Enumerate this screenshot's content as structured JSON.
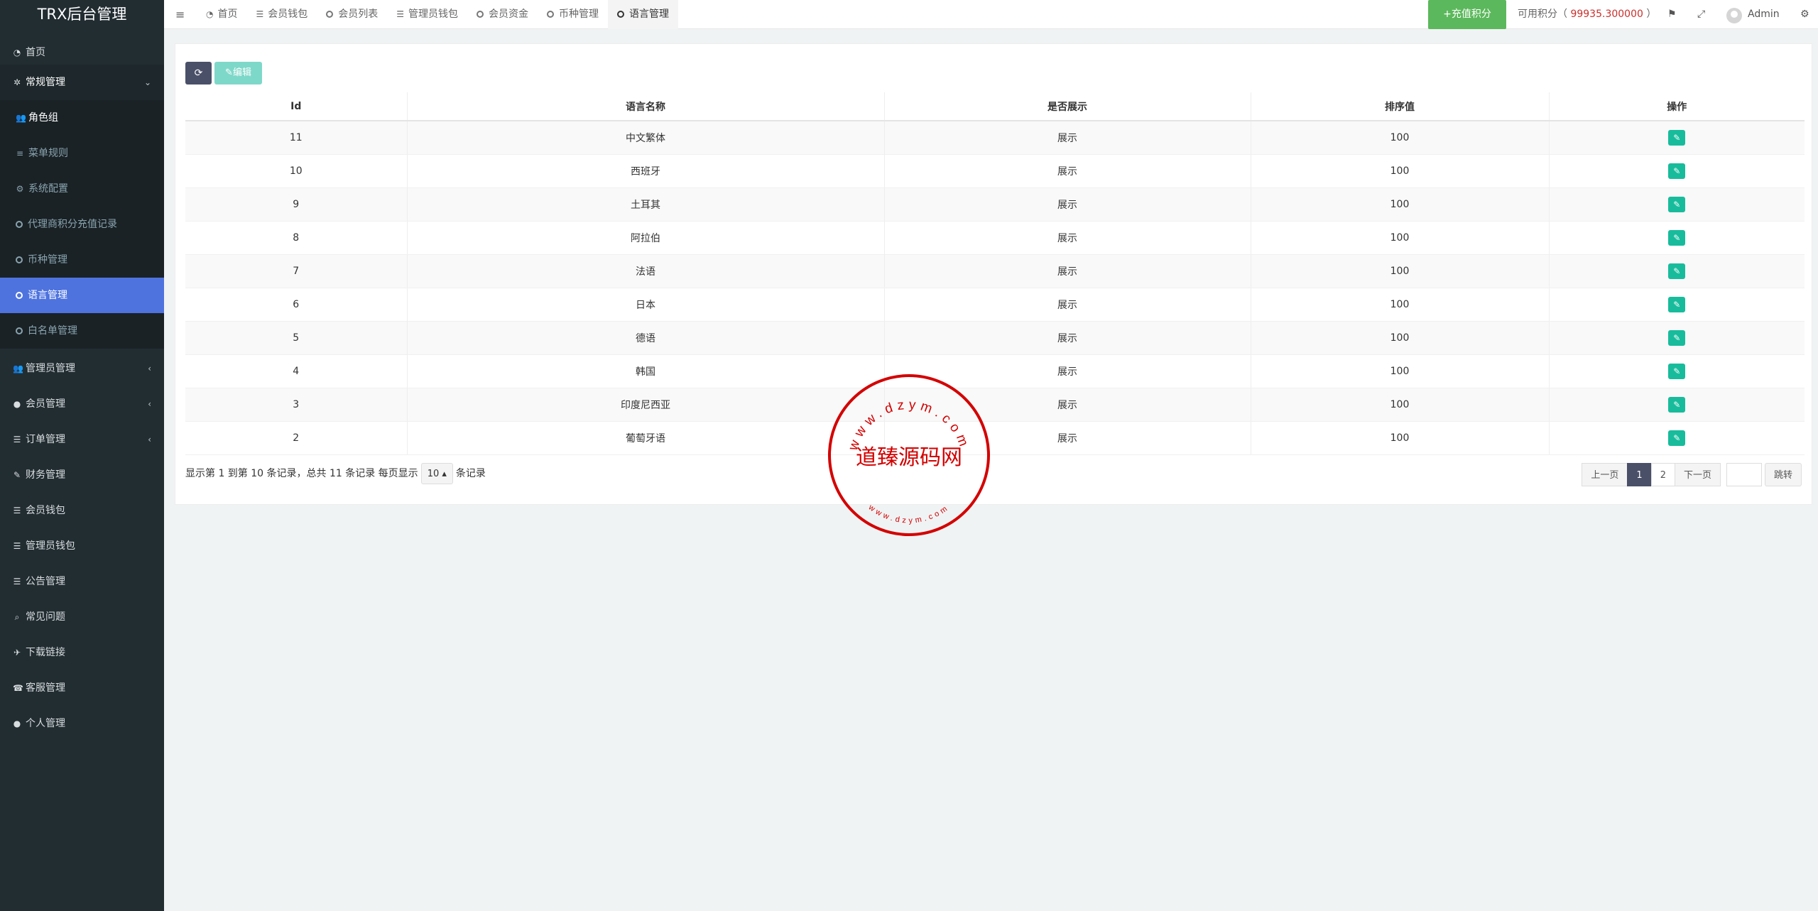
{
  "sidebar": {
    "logo": "TRX后台管理",
    "home": "首页",
    "regular": "常规管理",
    "sub": {
      "role_group": "角色组",
      "menu_rules": "菜单规则",
      "system_config": "系统配置",
      "agent_recharge": "代理商积分充值记录",
      "currency": "币种管理",
      "language": "语言管理",
      "whitelist": "白名单管理"
    },
    "items": [
      {
        "label": "管理员管理",
        "icon": "users-icon",
        "arrow": true
      },
      {
        "label": "会员管理",
        "icon": "user-icon",
        "arrow": true
      },
      {
        "label": "订单管理",
        "icon": "list-icon",
        "arrow": true
      },
      {
        "label": "财务管理",
        "icon": "edit-icon",
        "arrow": false
      },
      {
        "label": "会员钱包",
        "icon": "list-icon",
        "arrow": false
      },
      {
        "label": "管理员钱包",
        "icon": "list-icon",
        "arrow": false
      },
      {
        "label": "公告管理",
        "icon": "list-icon",
        "arrow": false
      },
      {
        "label": "常见问题",
        "icon": "search-icon",
        "arrow": false
      },
      {
        "label": "下载链接",
        "icon": "plane-icon",
        "arrow": false
      },
      {
        "label": "客服管理",
        "icon": "phone-icon",
        "arrow": false
      },
      {
        "label": "个人管理",
        "icon": "user-icon",
        "arrow": false
      }
    ]
  },
  "topbar": {
    "tabs": [
      {
        "label": "首页",
        "icon": "dashboard-icon"
      },
      {
        "label": "会员钱包",
        "icon": "list-icon"
      },
      {
        "label": "会员列表",
        "icon": "circle-icon"
      },
      {
        "label": "管理员钱包",
        "icon": "list-icon"
      },
      {
        "label": "会员资金",
        "icon": "circle-icon"
      },
      {
        "label": "币种管理",
        "icon": "circle-icon"
      },
      {
        "label": "语言管理",
        "icon": "circle-icon"
      }
    ],
    "recharge_label": "+充值积分",
    "points_label": "可用积分（",
    "points_value": "99935.300000",
    "points_close": "）",
    "admin": "Admin"
  },
  "toolbar": {
    "edit_label": "编辑"
  },
  "table": {
    "headers": {
      "id": "Id",
      "name": "语言名称",
      "show": "是否展示",
      "sort": "排序值",
      "op": "操作"
    },
    "rows": [
      {
        "id": "11",
        "name": "中文繁体",
        "show": "展示",
        "sort": "100"
      },
      {
        "id": "10",
        "name": "西班牙",
        "show": "展示",
        "sort": "100"
      },
      {
        "id": "9",
        "name": "土耳其",
        "show": "展示",
        "sort": "100"
      },
      {
        "id": "8",
        "name": "阿拉伯",
        "show": "展示",
        "sort": "100"
      },
      {
        "id": "7",
        "name": "法语",
        "show": "展示",
        "sort": "100"
      },
      {
        "id": "6",
        "name": "日本",
        "show": "展示",
        "sort": "100"
      },
      {
        "id": "5",
        "name": "德语",
        "show": "展示",
        "sort": "100"
      },
      {
        "id": "4",
        "name": "韩国",
        "show": "展示",
        "sort": "100"
      },
      {
        "id": "3",
        "name": "印度尼西亚",
        "show": "展示",
        "sort": "100"
      },
      {
        "id": "2",
        "name": "葡萄牙语",
        "show": "展示",
        "sort": "100"
      }
    ]
  },
  "footer": {
    "info_prefix": "显示第 1 到第 10 条记录，总共 11 条记录 每页显示",
    "page_size": "10",
    "info_suffix": "条记录"
  },
  "pager": {
    "prev": "上一页",
    "pages": [
      "1",
      "2"
    ],
    "next": "下一页",
    "go": "跳转"
  },
  "watermark": {
    "center": "道臻源码网",
    "ring_top": "www.dzym.com",
    "ring_bottom": "www.dzym.com"
  }
}
